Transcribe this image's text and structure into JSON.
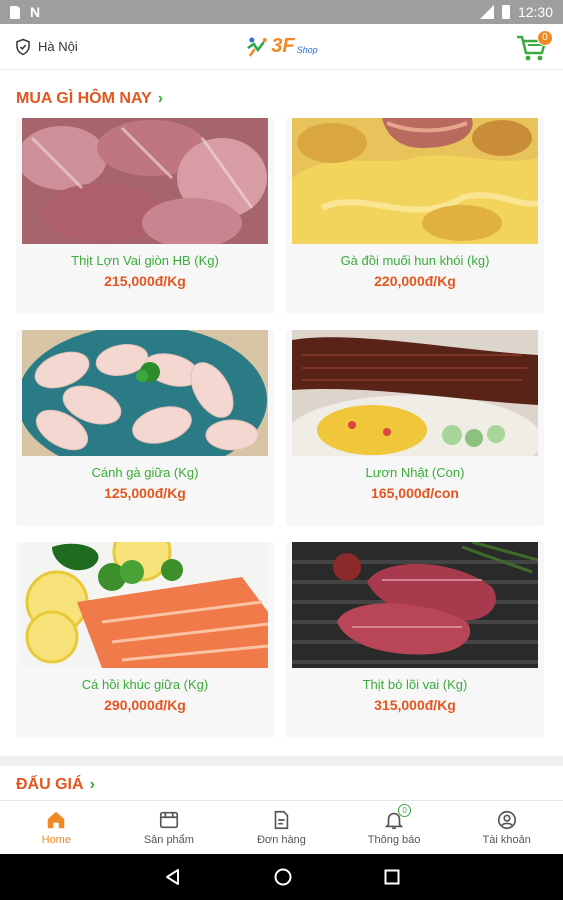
{
  "status_bar": {
    "time": "12:30",
    "icons": [
      "sd-card-icon",
      "n-icon",
      "signal-icon",
      "battery-icon"
    ]
  },
  "header": {
    "location_icon": "location-shield-icon",
    "location": "Hà Nội",
    "logo_text": "3F",
    "logo_sub": "Shop",
    "cart_icon": "cart-icon",
    "cart_count": "0"
  },
  "sections": {
    "today": {
      "title": "MUA GÌ HÔM NAY",
      "chevron": "›"
    },
    "auction": {
      "title": "ĐẤU GIÁ",
      "chevron": "›"
    }
  },
  "products": [
    {
      "name": "Thịt Lợn Vai giòn HB (Kg)",
      "price": "215,000đ/Kg",
      "image": "pork-shoulder"
    },
    {
      "name": "Gà đồi muối hun khói (kg)",
      "price": "220,000đ/Kg",
      "image": "smoked-chicken"
    },
    {
      "name": "Cánh gà giữa (Kg)",
      "price": "125,000đ/Kg",
      "image": "chicken-wings"
    },
    {
      "name": "Lươn Nhật (Con)",
      "price": "165,000đ/con",
      "image": "grilled-eel"
    },
    {
      "name": "Cá hồi khúc giữa (Kg)",
      "price": "290,000đ/Kg",
      "image": "salmon-fillet"
    },
    {
      "name": "Thịt bò lõi vai (Kg)",
      "price": "315,000đ/Kg",
      "image": "beef-steak"
    }
  ],
  "bottom_nav": [
    {
      "label": "Home",
      "icon": "home-icon",
      "active": true
    },
    {
      "label": "Sản phẩm",
      "icon": "products-icon",
      "active": false
    },
    {
      "label": "Đơn hàng",
      "icon": "orders-icon",
      "active": false
    },
    {
      "label": "Thông báo",
      "icon": "bell-icon",
      "active": false,
      "badge": "0"
    },
    {
      "label": "Tài khoản",
      "icon": "account-icon",
      "active": false
    }
  ],
  "colors": {
    "accent": "#f08a24",
    "title_red": "#e4561f",
    "green": "#3bab3b"
  }
}
